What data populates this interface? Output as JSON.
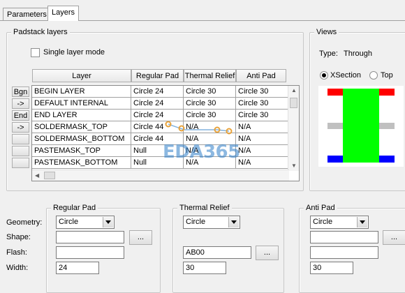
{
  "tabs": [
    {
      "label": "Parameters",
      "active": false
    },
    {
      "label": "Layers",
      "active": true
    }
  ],
  "padstack": {
    "title": "Padstack layers",
    "single_layer_label": "Single layer mode",
    "single_layer_checked": false,
    "columns": [
      "Layer",
      "Regular Pad",
      "Thermal Relief",
      "Anti Pad"
    ],
    "side_buttons": [
      "Bgn",
      "->",
      "End",
      "->",
      "",
      "",
      ""
    ],
    "rows": [
      [
        "BEGIN LAYER",
        "Circle 24",
        "Circle 30",
        "Circle 30"
      ],
      [
        "DEFAULT INTERNAL",
        "Circle 24",
        "Circle 30",
        "Circle 30"
      ],
      [
        "END LAYER",
        "Circle 24",
        "Circle 30",
        "Circle 30"
      ],
      [
        "SOLDERMASK_TOP",
        "Circle 44",
        "N/A",
        "N/A"
      ],
      [
        "SOLDERMASK_BOTTOM",
        "Circle 44",
        "N/A",
        "N/A"
      ],
      [
        "PASTEMASK_TOP",
        "Null",
        "N/A",
        "N/A"
      ],
      [
        "PASTEMASK_BOTTOM",
        "Null",
        "N/A",
        "N/A"
      ]
    ]
  },
  "views": {
    "title": "Views",
    "type_label": "Type:",
    "type_value": "Through",
    "radio_xsection": "XSection",
    "radio_top": "Top",
    "selected": "XSection",
    "colors": {
      "top_pad": "#ff0000",
      "body": "#00ff00",
      "inner": "#c0c0c0",
      "bottom_pad": "#0000ff"
    }
  },
  "form": {
    "row_labels": [
      "Geometry:",
      "Shape:",
      "Flash:",
      "Width:"
    ],
    "regular_pad": {
      "title": "Regular Pad",
      "geometry": "Circle",
      "shape": "",
      "flash": "",
      "width": "24"
    },
    "thermal_relief": {
      "title": "Thermal Relief",
      "geometry": "Circle",
      "flash": "AB00",
      "width": "30"
    },
    "anti_pad": {
      "title": "Anti Pad",
      "geometry": "Circle",
      "shape": "",
      "flash": "",
      "width": "30"
    },
    "browse_label": "..."
  },
  "watermark": {
    "text": "EDA365"
  }
}
